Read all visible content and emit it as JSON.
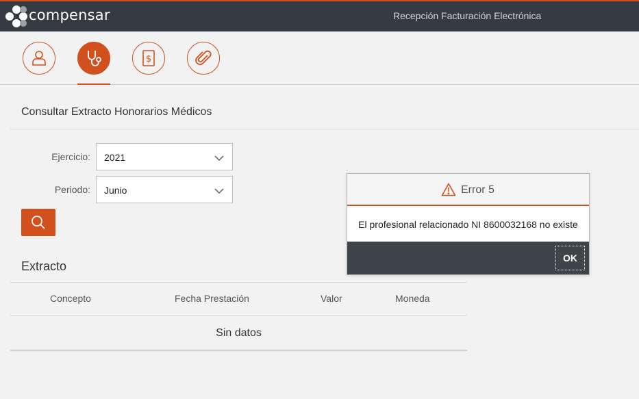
{
  "header": {
    "brand": "compensar",
    "app_title": "Recepción Facturación Electrónica"
  },
  "nav": {
    "items": [
      {
        "icon": "user-icon",
        "active": false
      },
      {
        "icon": "stethoscope-icon",
        "active": true
      },
      {
        "icon": "dollar-document-icon",
        "active": false
      },
      {
        "icon": "paperclip-icon",
        "active": false
      }
    ]
  },
  "form": {
    "title": "Consultar Extracto Honorarios Médicos",
    "ejercicio_label": "Ejercicio:",
    "ejercicio_value": "2021",
    "periodo_label": "Periodo:",
    "periodo_value": "Junio"
  },
  "extracto": {
    "title": "Extracto",
    "columns": [
      "Concepto",
      "Fecha Prestación",
      "Valor",
      "Moneda"
    ],
    "empty_text": "Sin datos"
  },
  "dialog": {
    "title": "Error 5",
    "message": "El profesional relacionado NI 8600032168 no existe",
    "ok_label": "OK"
  },
  "colors": {
    "accent": "#d2501e",
    "topbar": "#353b40",
    "dialog_footer": "#3e4447"
  }
}
